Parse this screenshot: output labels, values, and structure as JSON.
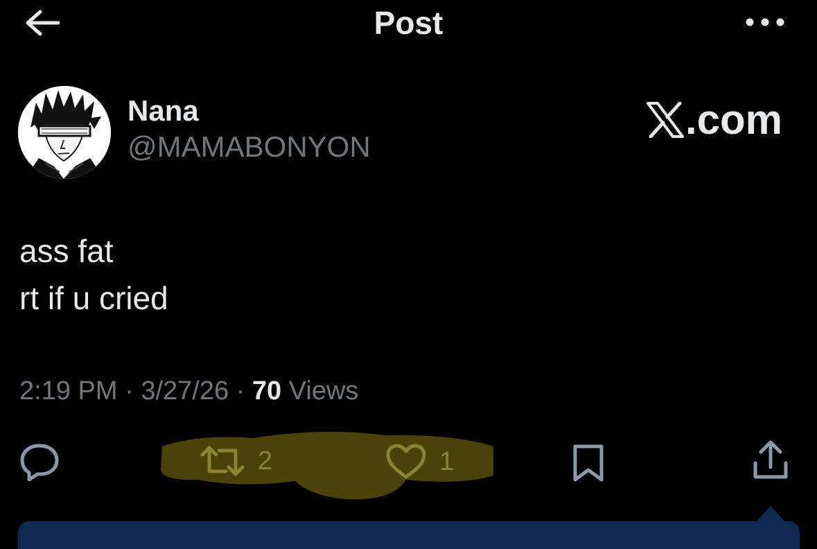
{
  "header": {
    "title": "Post",
    "back_icon": "arrow-left-icon",
    "more_icon": "more-horizontal-icon"
  },
  "author": {
    "display_name": "Nana",
    "handle": "@MAMABONYON"
  },
  "watermark": {
    "text": ".com",
    "logo": "x-logo"
  },
  "post": {
    "text": "ass fat\nrt if u cried"
  },
  "meta": {
    "time": "2:19 PM",
    "separator": "·",
    "date": "3/27/26",
    "views_count": "70",
    "views_label": "Views"
  },
  "actions": {
    "reply_icon": "reply-icon",
    "repost_icon": "repost-icon",
    "repost_count": "2",
    "like_icon": "heart-icon",
    "like_count": "1",
    "bookmark_icon": "bookmark-icon",
    "share_icon": "share-icon"
  },
  "colors": {
    "background": "#000000",
    "primary_text": "#e7e9ea",
    "secondary_text": "#71767b",
    "highlight": "#5a4f0a",
    "highlighted_icon": "#8b8236"
  }
}
